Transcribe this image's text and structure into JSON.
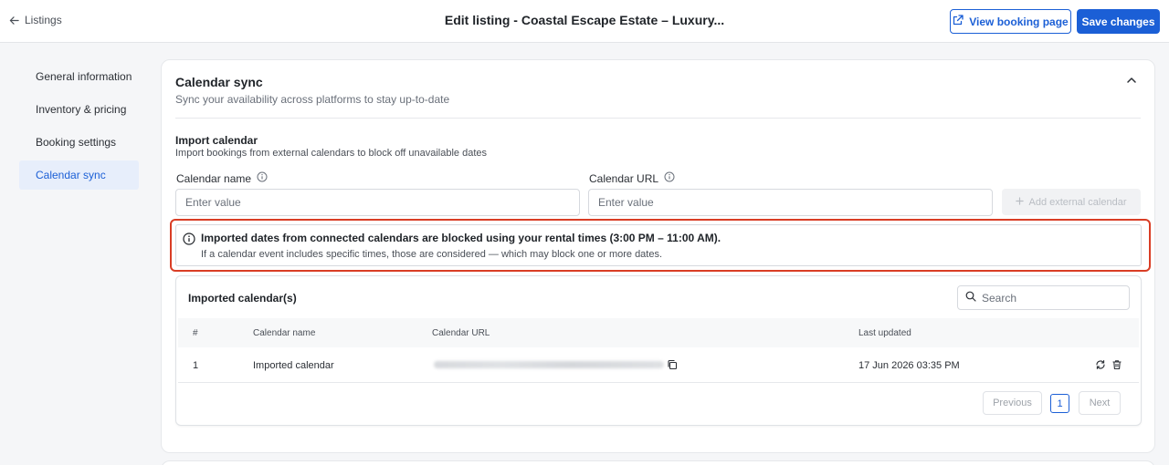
{
  "topbar": {
    "back_label": "Listings",
    "title": "Edit listing - Coastal Escape Estate – Luxury...",
    "view_booking_label": "View booking page",
    "save_label": "Save changes"
  },
  "sidebar": {
    "items": [
      {
        "label": "General information"
      },
      {
        "label": "Inventory & pricing"
      },
      {
        "label": "Booking settings"
      },
      {
        "label": "Calendar sync"
      }
    ],
    "active": "Calendar sync"
  },
  "section": {
    "title": "Calendar sync",
    "subtitle": "Sync your availability across platforms to stay up-to-date"
  },
  "import": {
    "title": "Import calendar",
    "subtitle": "Import bookings from external calendars to block off unavailable dates",
    "name_label": "Calendar name",
    "name_placeholder": "Enter value",
    "url_label": "Calendar URL",
    "url_placeholder": "Enter value",
    "add_button_label": "Add external calendar"
  },
  "notice": {
    "title": "Imported dates from connected calendars are blocked using your rental times (3:00 PM – 11:00 AM).",
    "body": "If a calendar event includes specific times, those are considered — which may block one or more dates."
  },
  "table": {
    "title": "Imported calendar(s)",
    "search_placeholder": "Search",
    "columns": [
      "#",
      "Calendar name",
      "Calendar URL",
      "Last updated"
    ],
    "rows": [
      {
        "index": "1",
        "name": "Imported calendar",
        "last_updated": "17 Jun 2026 03:35 PM"
      }
    ],
    "pagination": {
      "previous": "Previous",
      "current": "1",
      "next": "Next"
    }
  },
  "colors": {
    "accent": "#1b5fd6",
    "highlight_border": "#d93d25",
    "active_nav_bg": "#e7eefb"
  }
}
